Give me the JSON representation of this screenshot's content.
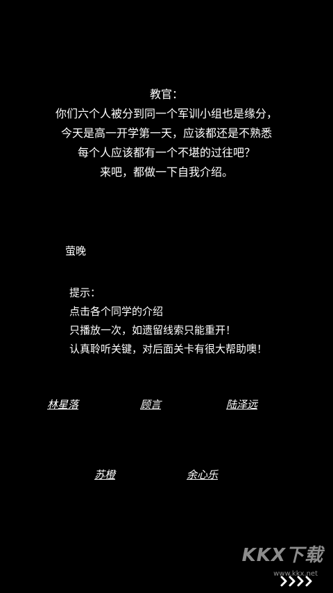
{
  "dialog": {
    "speaker": "教官：",
    "lines": [
      "你们六个人被分到同一个军训小组也是缘分，",
      "今天是高一开学第一天，应该都还是不熟悉",
      "每个人应该都有一个不堪的过往吧？",
      "来吧，都做一下自我介绍。"
    ]
  },
  "player_name": "萤晚",
  "hint": {
    "title": "提示：",
    "lines": [
      "点击各个同学的介绍",
      "只播放一次，如遗留线索只能重开！",
      "认真聆听关键，对后面关卡有很大帮助噢！"
    ]
  },
  "students": [
    {
      "name": "林星落"
    },
    {
      "name": "顾言"
    },
    {
      "name": "陆泽远"
    },
    {
      "name": "苏橙"
    },
    {
      "name": "余心乐"
    }
  ],
  "watermark": {
    "logo": "KKX下载",
    "url": "www.kkx.net"
  },
  "skip_icon": "fast-forward-chevrons",
  "colors": {
    "background": "#000000",
    "text": "#ffffff"
  }
}
